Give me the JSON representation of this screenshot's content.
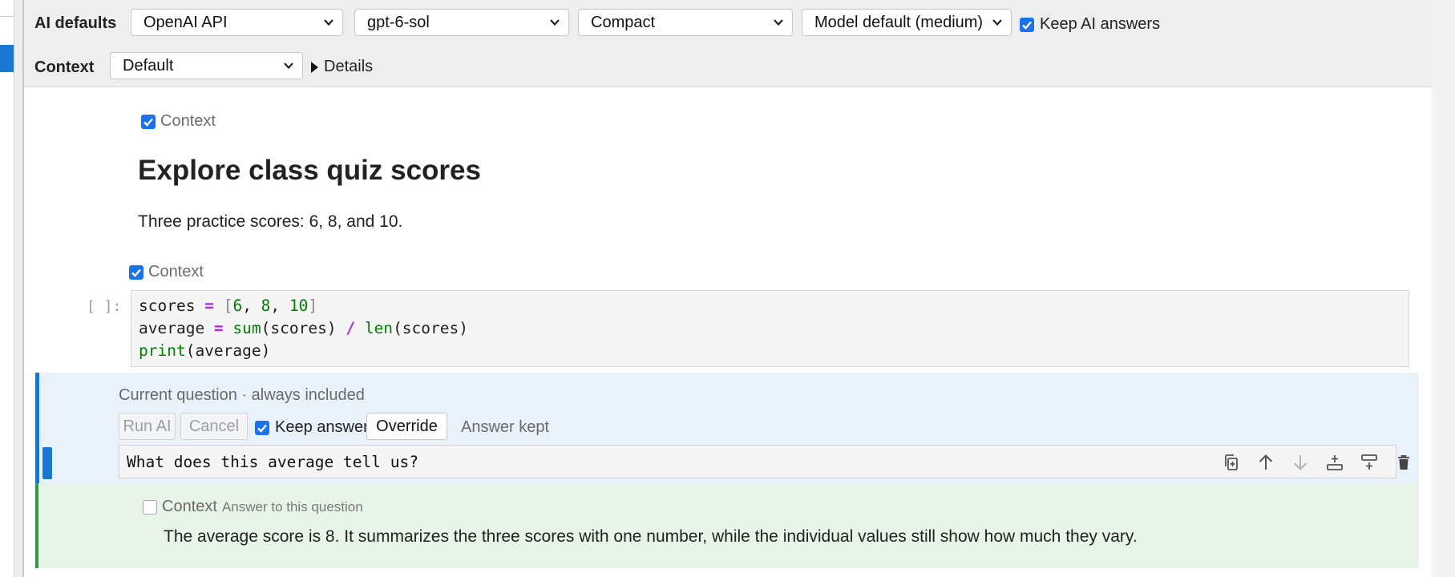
{
  "toolbar": {
    "ai_defaults_label": "AI defaults",
    "provider": "OpenAI API",
    "model": "gpt-6-sol",
    "mode": "Compact",
    "effort": "Model default (medium)",
    "keep_answers_label": "Keep AI answers"
  },
  "context_bar": {
    "label": "Context",
    "value": "Default",
    "details_label": "Details"
  },
  "markdown_cell": {
    "context_label": "Context",
    "heading": "Explore class quiz scores",
    "paragraph": "Three practice scores: 6, 8, and 10."
  },
  "code_cell": {
    "context_label": "Context",
    "prompt": "[ ]:",
    "lines": [
      "scores = [6, 8, 10]",
      "average = sum(scores) / len(scores)",
      "print(average)"
    ]
  },
  "question_cell": {
    "label": "Current question · always included",
    "run_label": "Run AI",
    "cancel_label": "Cancel",
    "keep_label": "Keep answer",
    "override_label": "Override",
    "status": "Answer kept",
    "question": "What does this average tell us?",
    "tools": [
      "duplicate-icon",
      "move-up-icon",
      "move-down-icon",
      "insert-above-icon",
      "insert-below-icon",
      "delete-icon"
    ]
  },
  "answer_cell": {
    "context_label": "Context",
    "caption": "Answer to this question",
    "text": "The average score is 8. It summarizes the three scores with one number, while the individual values still show how much they vary."
  },
  "colors": {
    "accent": "#1976d2",
    "checkbox": "#1a73e8",
    "answer_accent": "#2e9e3a",
    "code_keyword": "#008000",
    "code_operator": "#aa22ff"
  }
}
